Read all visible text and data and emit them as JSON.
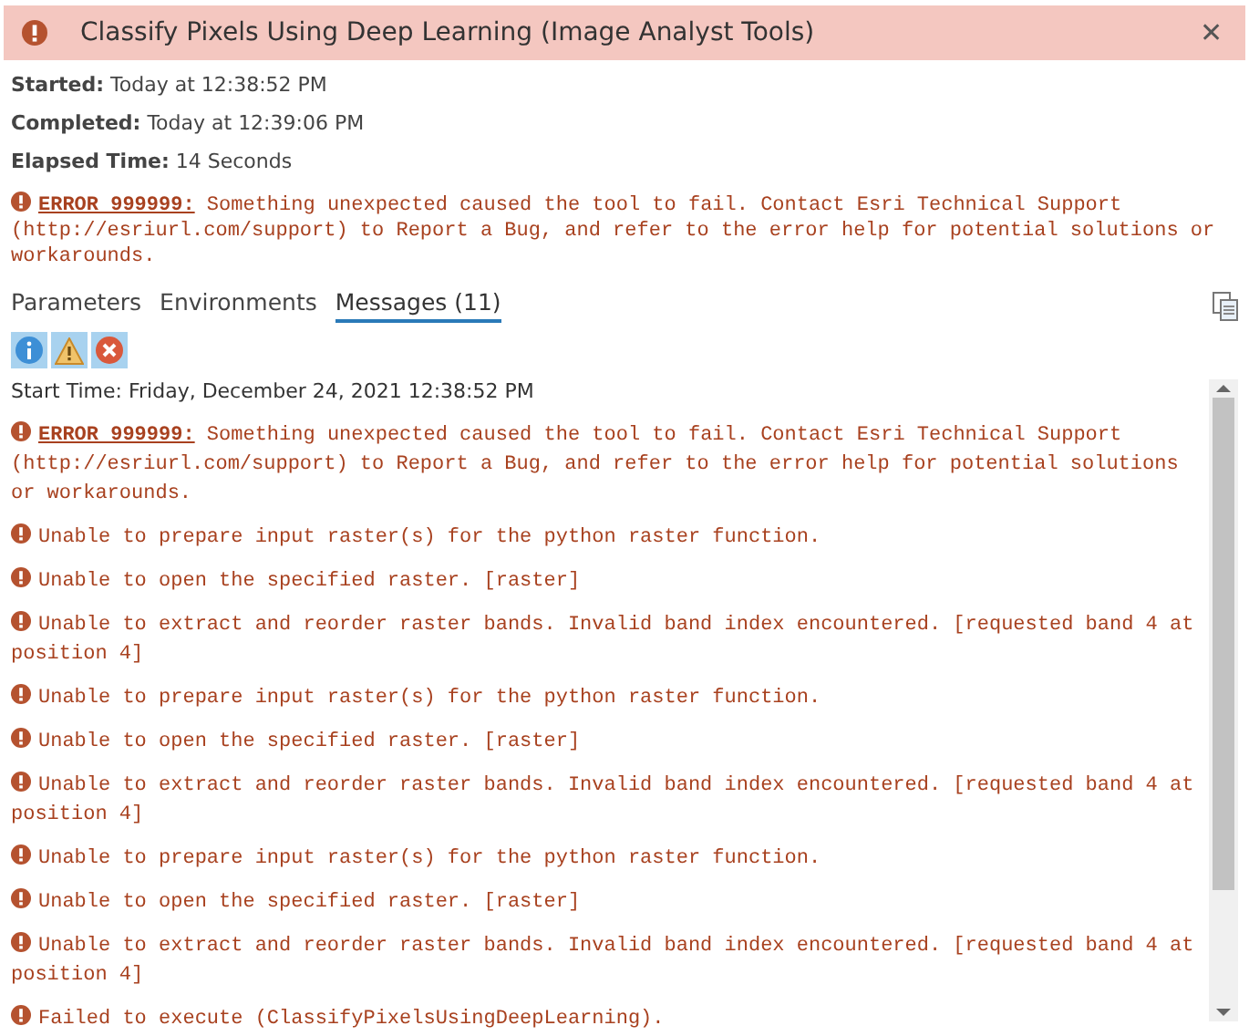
{
  "header": {
    "title": "Classify Pixels Using Deep Learning (Image Analyst Tools)",
    "close": "✕"
  },
  "info": [
    {
      "label": "Started:",
      "value": "Today at 12:38:52 PM"
    },
    {
      "label": "Completed:",
      "value": "Today at 12:39:06 PM"
    },
    {
      "label": "Elapsed Time:",
      "value": "14 Seconds"
    }
  ],
  "summary_error": {
    "code": "ERROR 999999:",
    "text": " Something unexpected caused the tool to fail. Contact Esri Technical Support (http://esriurl.com/support) to Report a Bug, and refer to the error help for potential solutions or workarounds."
  },
  "tabs": [
    {
      "label": "Parameters",
      "selected": false
    },
    {
      "label": "Environments",
      "selected": false
    },
    {
      "label": "Messages (11)",
      "selected": true
    }
  ],
  "filters": [
    {
      "kind": "info",
      "on": true
    },
    {
      "kind": "warning",
      "on": true
    },
    {
      "kind": "error",
      "on": true
    }
  ],
  "messages": [
    {
      "kind": "plain",
      "text": "Start Time: Friday, December 24, 2021 12:38:52 PM"
    },
    {
      "kind": "error",
      "code": "ERROR 999999:",
      "text": " Something unexpected caused the tool to fail. Contact Esri Technical Support (http://esriurl.com/support) to Report a Bug, and refer to the error help for potential solutions or workarounds."
    },
    {
      "kind": "error",
      "text": "Unable to prepare input raster(s) for the python raster function."
    },
    {
      "kind": "error",
      "text": "Unable to open the specified raster. [raster]"
    },
    {
      "kind": "error",
      "text": "Unable to extract and reorder raster bands. Invalid band index encountered. [requested band 4 at position 4]"
    },
    {
      "kind": "error",
      "text": "Unable to prepare input raster(s) for the python raster function."
    },
    {
      "kind": "error",
      "text": "Unable to open the specified raster. [raster]"
    },
    {
      "kind": "error",
      "text": "Unable to extract and reorder raster bands. Invalid band index encountered. [requested band 4 at position 4]"
    },
    {
      "kind": "error",
      "text": "Unable to prepare input raster(s) for the python raster function."
    },
    {
      "kind": "error",
      "text": "Unable to open the specified raster. [raster]"
    },
    {
      "kind": "error",
      "text": "Unable to extract and reorder raster bands. Invalid band index encountered. [requested band 4 at position 4]"
    },
    {
      "kind": "error",
      "text": "Failed to execute (ClassifyPixelsUsingDeepLearning)."
    }
  ]
}
